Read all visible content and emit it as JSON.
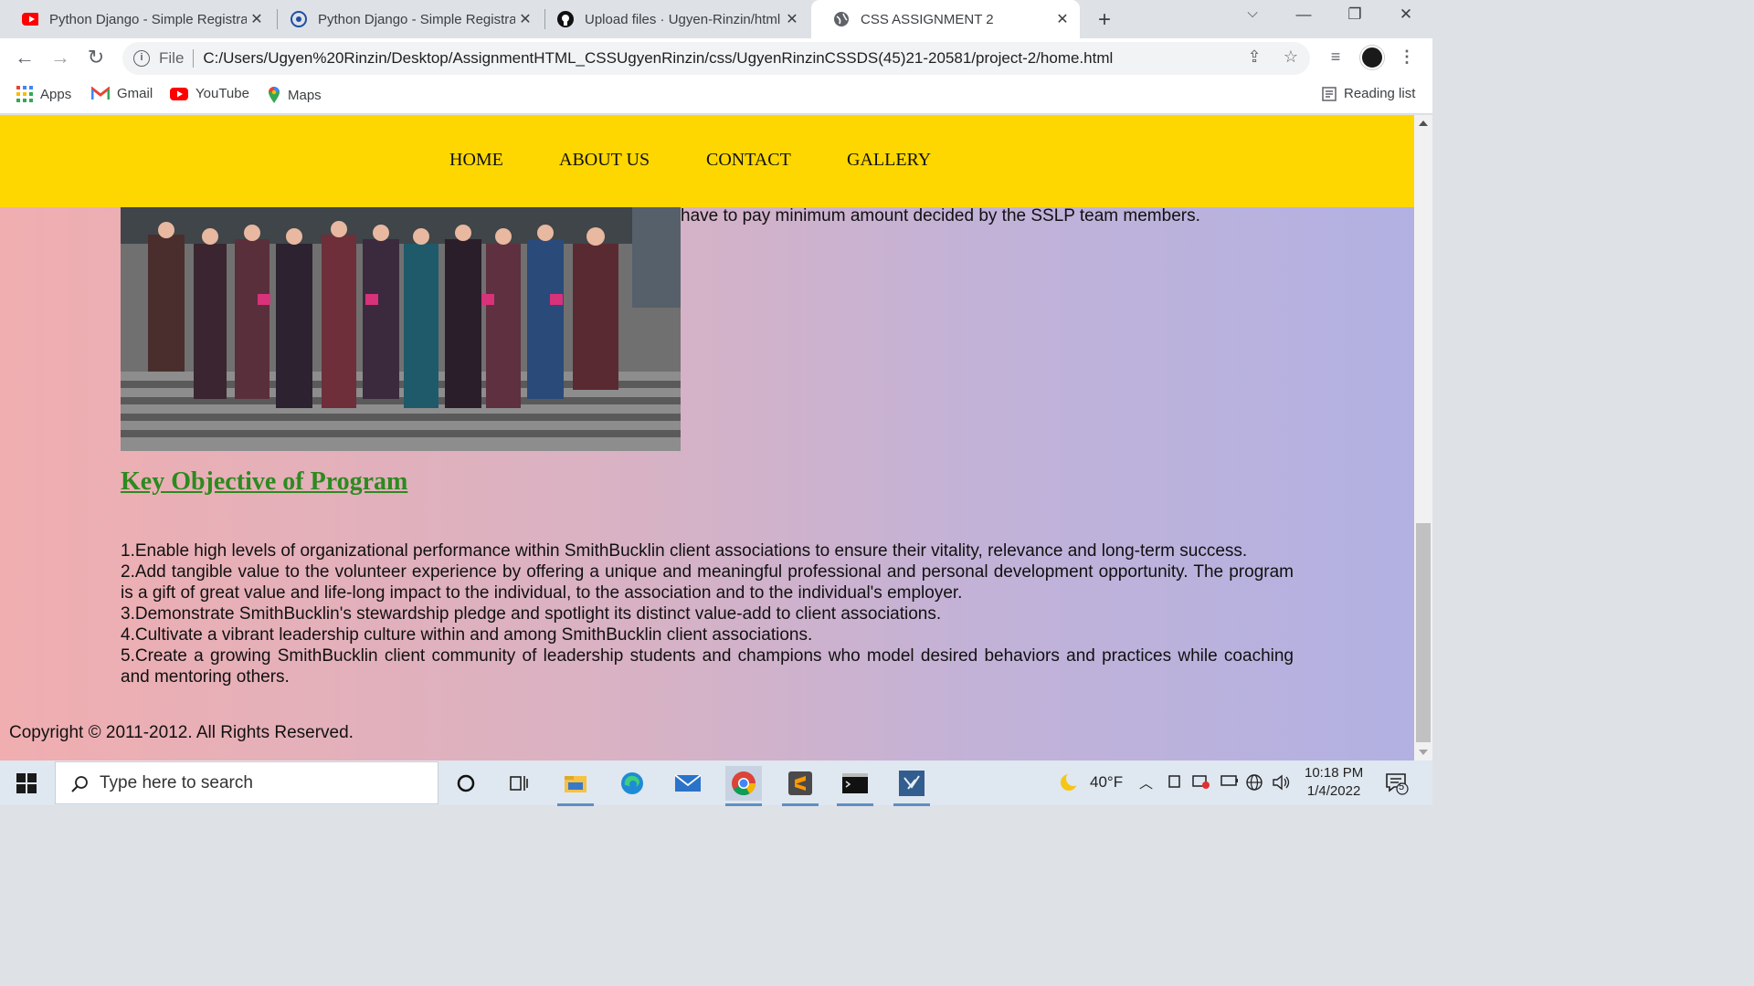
{
  "browser": {
    "tabs": [
      {
        "title": "Python Django - Simple Registrat",
        "icon": "youtube-icon",
        "active": false
      },
      {
        "title": "Python Django - Simple Registrat",
        "icon": "site-icon",
        "active": false
      },
      {
        "title": "Upload files · Ugyen-Rinzin/html",
        "icon": "github-icon",
        "active": false
      },
      {
        "title": "CSS ASSIGNMENT 2",
        "icon": "globe-icon",
        "active": true
      }
    ],
    "address": {
      "scheme_label": "File",
      "url": "C:/Users/Ugyen%20Rinzin/Desktop/AssignmentHTML_CSSUgyenRinzin/css/UgyenRinzinCSSDS(45)21-20581/project-2/home.html"
    },
    "bookmarks": [
      {
        "label": "Apps",
        "icon": "apps-grid-icon"
      },
      {
        "label": "Gmail",
        "icon": "gmail-icon"
      },
      {
        "label": "YouTube",
        "icon": "youtube-icon"
      },
      {
        "label": "Maps",
        "icon": "maps-pin-icon"
      }
    ],
    "reading_list_label": "Reading list"
  },
  "page": {
    "nav": [
      "HOME",
      "ABOUT US",
      "CONTACT",
      "GALLERY"
    ],
    "side_text": "have to pay minimum amount decided by the SSLP team members.",
    "heading": "Key Objective of Program",
    "objectives": [
      "1.Enable high levels of organizational performance within SmithBucklin client associations to ensure their vitality, relevance and long-term success.",
      "2.Add tangible value to the volunteer experience by offering a unique and meaningful professional and personal development opportunity. The program is a gift of great value and life-long impact to the individual, to the association and to the individual's employer.",
      "3.Demonstrate SmithBucklin's stewardship pledge and spotlight its distinct value-add to client associations.",
      "4.Cultivate a vibrant leadership culture within and among SmithBucklin client associations.",
      "5.Create a growing SmithBucklin client community of leadership students and champions who model desired behaviors and practices while coaching and mentoring others."
    ],
    "copyright": "Copyright © 2011-2012. All Rights Reserved.",
    "colors": {
      "navbar": "#ffd700",
      "heading": "#2c8a1f",
      "gradient_start": "#f0aeb0",
      "gradient_end": "#b2b1e2"
    }
  },
  "taskbar": {
    "search_placeholder": "Type here to search",
    "weather": "40°F",
    "time": "10:18 PM",
    "date": "1/4/2022",
    "notification_count": "5"
  }
}
